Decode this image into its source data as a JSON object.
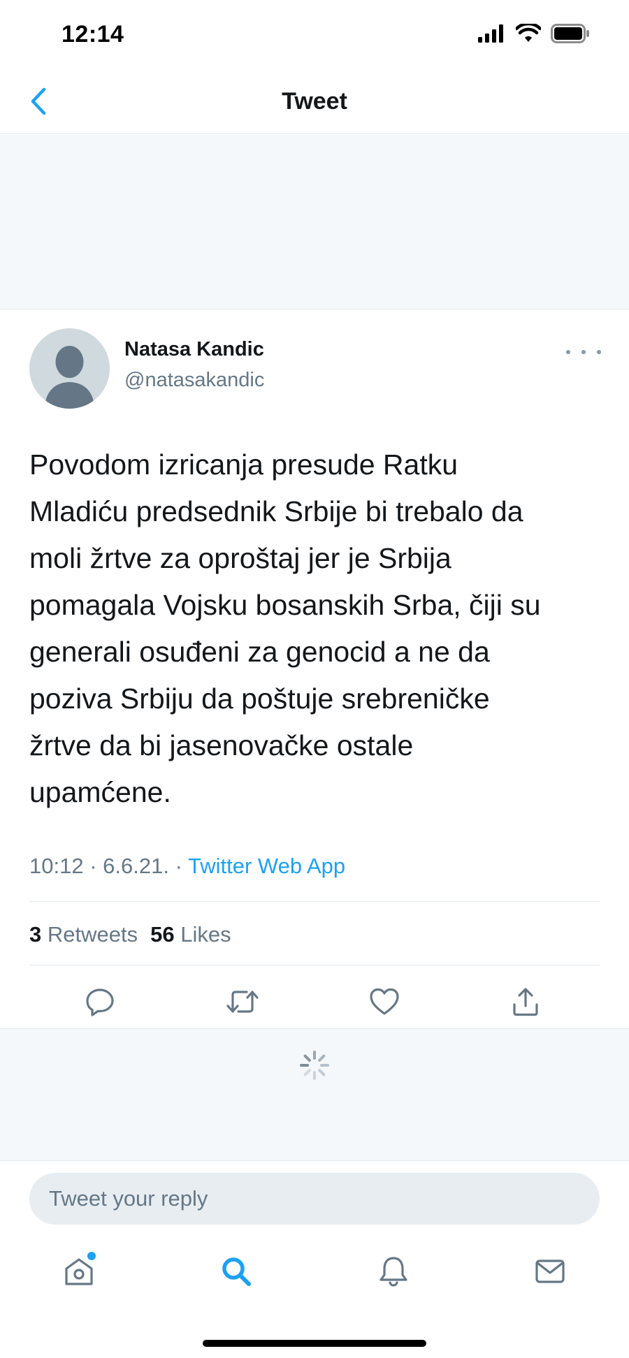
{
  "status_bar": {
    "time": "12:14",
    "icons": [
      "signal-icon",
      "wifi-icon",
      "battery-icon"
    ]
  },
  "nav": {
    "back_icon": "chevron-left-icon",
    "title": "Tweet"
  },
  "tweet": {
    "author_name": "Natasa Kandic",
    "author_handle": "@natasakandic",
    "text": "Povodom izricanja presude Ratku\nMladiću predsednik Srbije bi trebalo da\nmoli žrtve za oproštaj jer je Srbija\npomagala Vojsku bosanskih Srba, čiji su\ngenerali osuđeni za genocid a ne da\npoziva Srbiju da poštuje srebreničke\nžrtve da bi jasenovačke ostale\nupamćene.",
    "time": "10:12",
    "date": "6.6.21.",
    "separator": "·",
    "source": "Twitter Web App",
    "retweets_count": "3",
    "retweets_label": "Retweets",
    "likes_count": "56",
    "likes_label": "Likes",
    "actions": [
      "reply-icon",
      "retweet-icon",
      "like-icon",
      "share-icon"
    ]
  },
  "reply": {
    "placeholder": "Tweet your reply"
  },
  "tab_bar": {
    "tabs": [
      "home-icon",
      "search-icon",
      "notifications-icon",
      "messages-icon"
    ],
    "active": "search-icon"
  },
  "colors": {
    "accent": "#1da1f2",
    "text": "#14171a",
    "secondary": "#657786",
    "border": "#e1e8ed",
    "panel": "#f5f8fa"
  }
}
